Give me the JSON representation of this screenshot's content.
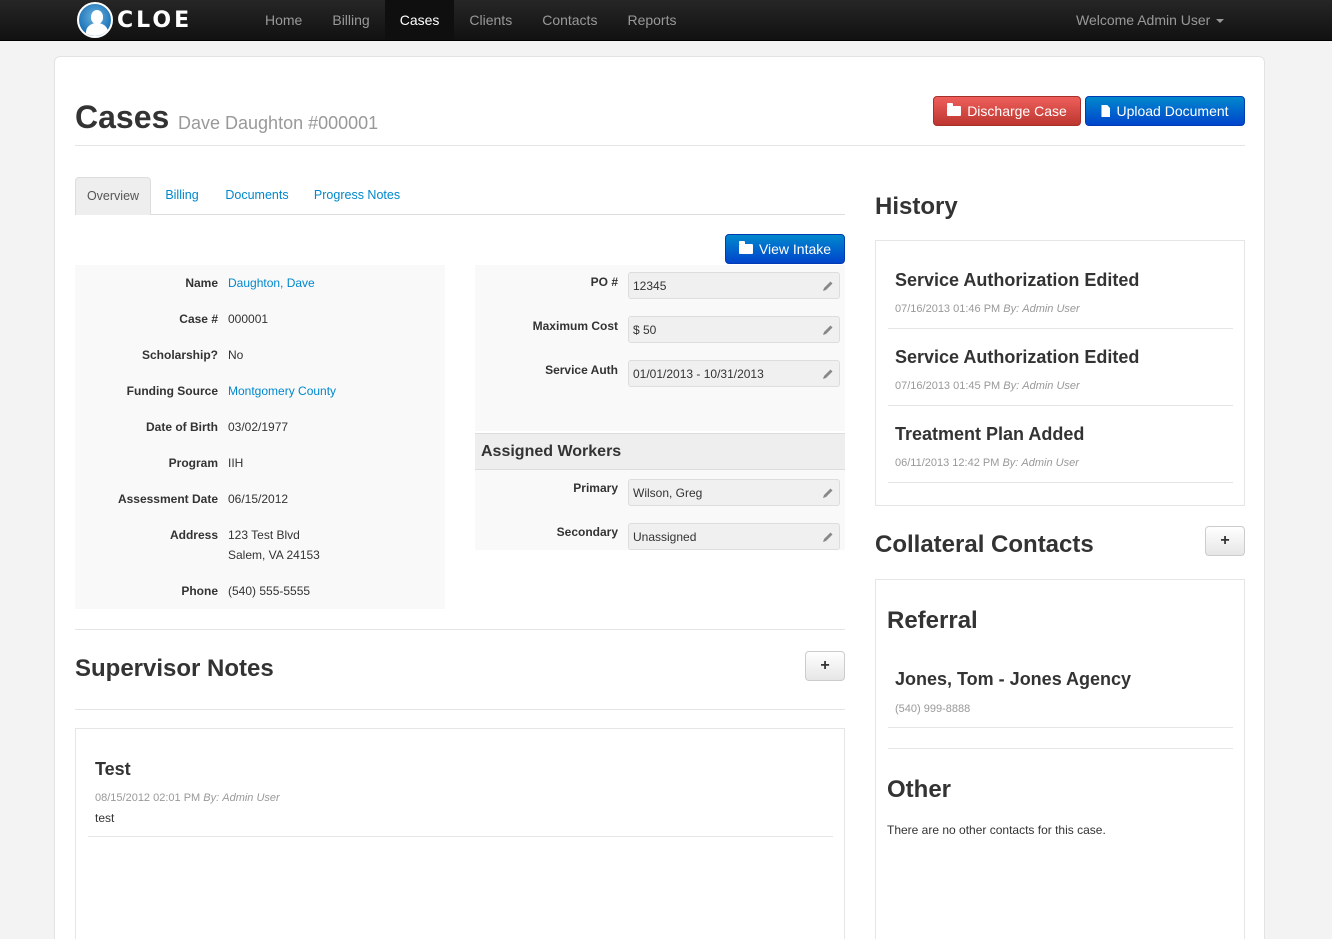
{
  "nav": {
    "brand": "CLOE",
    "items": [
      "Home",
      "Billing",
      "Cases",
      "Clients",
      "Contacts",
      "Reports"
    ],
    "active": "Cases",
    "welcome": "Welcome Admin User"
  },
  "header": {
    "title": "Cases",
    "subtitle": "Dave Daughton #000001",
    "discharge_label": "Discharge Case",
    "upload_label": "Upload Document"
  },
  "tabs": [
    "Overview",
    "Billing",
    "Documents",
    "Progress Notes"
  ],
  "view_intake_label": "View Intake",
  "client": {
    "name_label": "Name",
    "name": "Daughton, Dave",
    "case_label": "Case #",
    "case": "000001",
    "scholarship_label": "Scholarship?",
    "scholarship": "No",
    "funding_label": "Funding Source",
    "funding": "Montgomery County",
    "dob_label": "Date of Birth",
    "dob": "03/02/1977",
    "program_label": "Program",
    "program": "IIH",
    "assessment_label": "Assessment Date",
    "assessment": "06/15/2012",
    "address_label": "Address",
    "address_line1": "123 Test Blvd",
    "address_line2": "Salem, VA 24153",
    "phone_label": "Phone",
    "phone": "(540) 555-5555"
  },
  "auth": {
    "po_label": "PO #",
    "po": "12345",
    "cost_label": "Maximum Cost",
    "cost": "$ 50",
    "service_label": "Service Auth",
    "service": "01/01/2013 - 10/31/2013"
  },
  "workers": {
    "title": "Assigned Workers",
    "primary_label": "Primary",
    "primary": "Wilson, Greg",
    "secondary_label": "Secondary",
    "secondary": "Unassigned"
  },
  "supervisor_notes": {
    "title": "Supervisor Notes",
    "items": [
      {
        "title": "Test",
        "date": "08/15/2012 02:01 PM",
        "by_label": "By:",
        "by": "Admin User",
        "body": "test"
      }
    ]
  },
  "history": {
    "title": "History",
    "items": [
      {
        "title": "Service Authorization Edited",
        "date": "07/16/2013 01:46 PM",
        "by_label": "By:",
        "by": "Admin User"
      },
      {
        "title": "Service Authorization Edited",
        "date": "07/16/2013 01:45 PM",
        "by_label": "By:",
        "by": "Admin User"
      },
      {
        "title": "Treatment Plan Added",
        "date": "06/11/2013 12:42 PM",
        "by_label": "By:",
        "by": "Admin User"
      }
    ]
  },
  "collateral": {
    "title": "Collateral Contacts",
    "referral_title": "Referral",
    "referral_name": "Jones, Tom - Jones Agency",
    "referral_phone": "(540) 999-8888",
    "other_title": "Other",
    "other_text": "There are no other contacts for this case."
  },
  "colors": {
    "navbar": "#1b1b1b",
    "link": "#0088cc",
    "danger": "#da4f49",
    "primary": "#0066cc"
  }
}
